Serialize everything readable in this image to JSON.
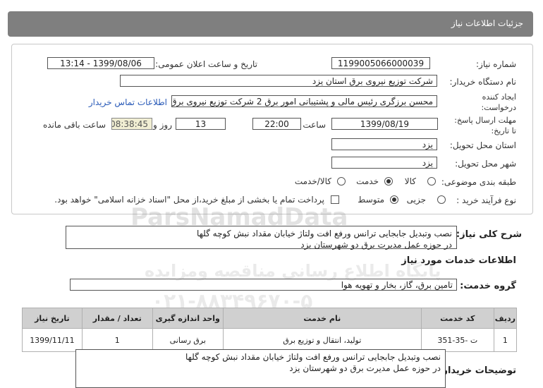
{
  "header": {
    "title": "جزئیات اطلاعات نیاز"
  },
  "fields": {
    "need_number_label": "شماره نیاز:",
    "need_number": "1199005066000039",
    "announce_label": "تاریخ و ساعت اعلان عمومی:",
    "announce_value": "1399/08/06 - 13:14",
    "buyer_label": "نام دستگاه خریدار:",
    "buyer": "شرکت توزیع نیروی برق استان یزد",
    "creator_label_1": "ایجاد کننده",
    "creator_label_2": "درخواست:",
    "creator": "محسن  برزگری رئیس مالی و پشتیبانی امور برق 2 شرکت توزیع نیروی برق استان یزد",
    "contact_link": "اطلاعات تماس خریدار",
    "deadline_label_1": "مهلت ارسال پاسخ:",
    "deadline_label_2": "تا تاریخ:",
    "deadline_date": "1399/08/19",
    "time_label": "ساعت",
    "deadline_time": "22:00",
    "days_value": "13",
    "days_label": "روز و",
    "remaining_value": "08:38:45",
    "remaining_label": "ساعت باقی مانده",
    "province_label": "استان محل تحویل:",
    "province": "یزد",
    "city_label": "شهر محل تحویل:",
    "city": "یزد",
    "category_label": "طبقه بندی موضوعی:",
    "category_options": [
      "کالا",
      "خدمت",
      "کالا/خدمت"
    ],
    "category_selected": "خدمت",
    "process_label": "نوع فرآیند خرید :",
    "process_options": [
      "جزیی",
      "متوسط"
    ],
    "process_selected": "متوسط",
    "payment_note": "پرداخت تمام یا بخشی از مبلغ خرید،از محل \"اسناد خزانه اسلامی\" خواهد بود."
  },
  "summary": {
    "label": "شرح کلی نیاز:",
    "line1": "نصب وتبدیل جابجایی ترانس ورفع افت ولتاژ خیابان مقداد نبش کوچه گلها",
    "line2": "در حوزه عمل مدیرت  برق دو شهرستان  یزد"
  },
  "services_section": {
    "title": "اطلاعات خدمات مورد نیاز",
    "group_label": "گروه خدمت:",
    "group_value": "تامین برق، گاز، بخار و تهویه هوا"
  },
  "table": {
    "headers": [
      "ردیف",
      "کد خدمت",
      "نام خدمت",
      "واحد اندازه گیری",
      "تعداد / مقدار",
      "تاریخ نیاز"
    ],
    "rows": [
      [
        "1",
        "ت -35-351",
        "تولید، انتقال و توزیع برق",
        "برق رسانی",
        "1",
        "1399/11/11"
      ]
    ]
  },
  "buyer_notes": {
    "label": "توضیحات خریدار:",
    "line1": "نصب وتبدیل جابجایی ترانس ورفع افت ولتاژ خیابان مقداد نبش کوچه گلها",
    "line2": "در حوزه عمل مدیرت  برق دو شهرستان  یزد"
  },
  "watermark": {
    "brand": "ParsNamadData",
    "line1": "پایگاه اطلاع رسانی مناقصه ومزایده",
    "line2": "۰۲۱-۸۸۳۴۹۶۷۰-۵"
  }
}
